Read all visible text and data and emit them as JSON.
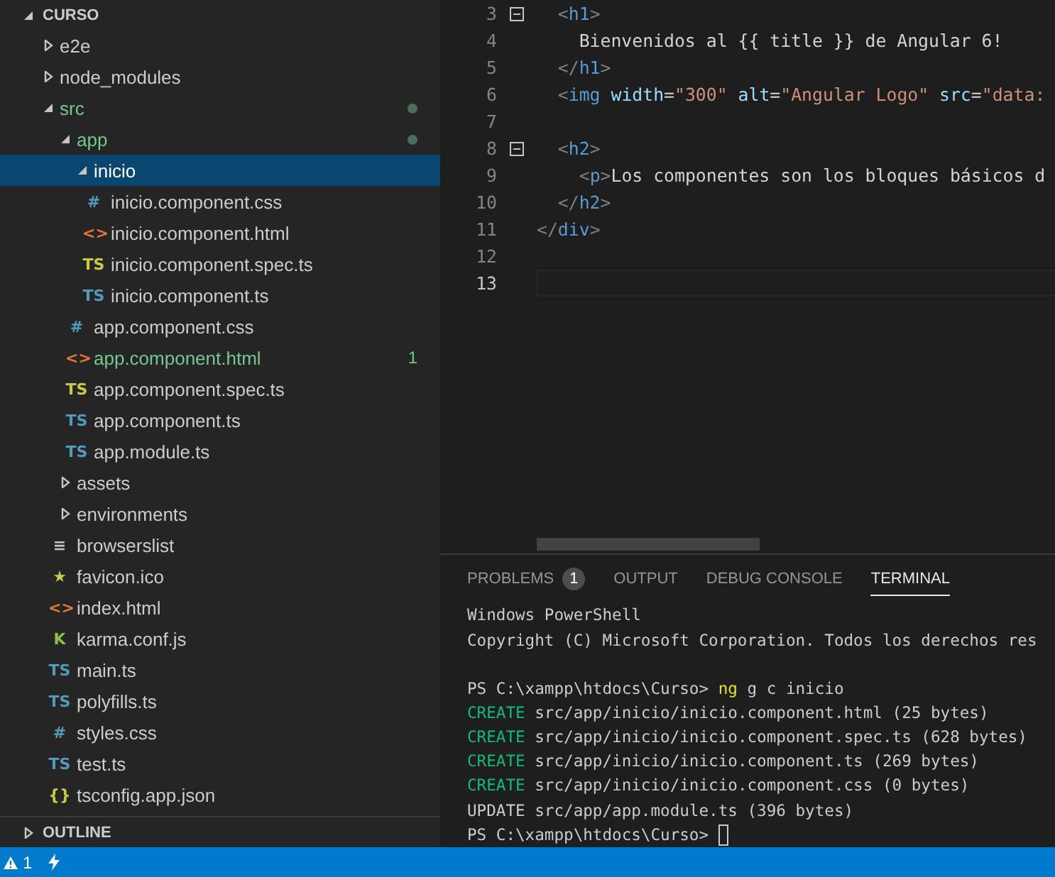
{
  "explorer": {
    "title": "CURSO",
    "expanded": true,
    "tree": [
      {
        "name": "e2e",
        "expanded": false
      },
      {
        "name": "node_modules",
        "expanded": false
      },
      {
        "name": "src",
        "expanded": true,
        "modified": true,
        "dot": true,
        "children": [
          {
            "name": "app",
            "expanded": true,
            "modified": true,
            "dot": true,
            "children": [
              {
                "name": "inicio",
                "expanded": true,
                "selected": true,
                "children": [
                  {
                    "kind": "css",
                    "icon": "#",
                    "name": "inicio.component.css"
                  },
                  {
                    "kind": "html",
                    "icon": "<>",
                    "name": "inicio.component.html"
                  },
                  {
                    "kind": "spec",
                    "icon": "TS",
                    "name": "inicio.component.spec.ts"
                  },
                  {
                    "kind": "ts",
                    "icon": "TS",
                    "name": "inicio.component.ts"
                  }
                ]
              },
              {
                "kind": "css",
                "icon": "#",
                "name": "app.component.css"
              },
              {
                "kind": "html",
                "icon": "<>",
                "name": "app.component.html",
                "modified": true,
                "badge": "1"
              },
              {
                "kind": "spec",
                "icon": "TS",
                "name": "app.component.spec.ts"
              },
              {
                "kind": "ts",
                "icon": "TS",
                "name": "app.component.ts"
              },
              {
                "kind": "ts",
                "icon": "TS",
                "name": "app.module.ts"
              }
            ]
          },
          {
            "name": "assets",
            "expanded": false
          },
          {
            "name": "environments",
            "expanded": false
          },
          {
            "kind": "list",
            "icon": "≡",
            "name": "browserslist"
          },
          {
            "kind": "favicon",
            "icon": "★",
            "name": "favicon.ico"
          },
          {
            "kind": "html",
            "icon": "<>",
            "name": "index.html"
          },
          {
            "kind": "karma",
            "icon": "K",
            "name": "karma.conf.js"
          },
          {
            "kind": "ts",
            "icon": "TS",
            "name": "main.ts"
          },
          {
            "kind": "ts",
            "icon": "TS",
            "name": "polyfills.ts"
          },
          {
            "kind": "css",
            "icon": "#",
            "name": "styles.css"
          },
          {
            "kind": "ts",
            "icon": "TS",
            "name": "test.ts"
          },
          {
            "kind": "json",
            "icon": "{}",
            "name": "tsconfig.app.json"
          }
        ]
      }
    ]
  },
  "outline": {
    "title": "OUTLINE",
    "expanded": false
  },
  "editor": {
    "lines": [
      {
        "number": "3",
        "foldable": true,
        "current": false,
        "tokens": [
          {
            "kind": "punct",
            "text": "  <"
          },
          {
            "kind": "tag",
            "text": "h1"
          },
          {
            "kind": "punct",
            "text": ">"
          }
        ]
      },
      {
        "number": "4",
        "foldable": false,
        "current": false,
        "tokens": [
          {
            "kind": "text",
            "text": "    Bienvenidos al {{ title }} de Angular 6!"
          }
        ]
      },
      {
        "number": "5",
        "foldable": false,
        "current": false,
        "tokens": [
          {
            "kind": "punct",
            "text": "  </"
          },
          {
            "kind": "tag",
            "text": "h1"
          },
          {
            "kind": "punct",
            "text": ">"
          }
        ]
      },
      {
        "number": "6",
        "foldable": false,
        "current": false,
        "tokens": [
          {
            "kind": "punct",
            "text": "  <"
          },
          {
            "kind": "tag",
            "text": "img"
          },
          {
            "kind": "attr",
            "text": " width"
          },
          {
            "kind": "text",
            "text": "="
          },
          {
            "kind": "string",
            "text": "\"300\""
          },
          {
            "kind": "attr",
            "text": " alt"
          },
          {
            "kind": "text",
            "text": "="
          },
          {
            "kind": "string",
            "text": "\"Angular Logo\""
          },
          {
            "kind": "attr",
            "text": " src"
          },
          {
            "kind": "text",
            "text": "="
          },
          {
            "kind": "string",
            "text": "\"data:"
          }
        ]
      },
      {
        "number": "7",
        "foldable": false,
        "current": false
      },
      {
        "number": "8",
        "foldable": true,
        "current": false,
        "tokens": [
          {
            "kind": "punct",
            "text": "  <"
          },
          {
            "kind": "tag",
            "text": "h2"
          },
          {
            "kind": "punct",
            "text": ">"
          }
        ]
      },
      {
        "number": "9",
        "foldable": false,
        "current": false,
        "tokens": [
          {
            "kind": "punct",
            "text": "    <"
          },
          {
            "kind": "tag",
            "text": "p"
          },
          {
            "kind": "punct",
            "text": ">"
          },
          {
            "kind": "text",
            "text": "Los componentes son los bloques básicos d"
          }
        ]
      },
      {
        "number": "10",
        "foldable": false,
        "current": false,
        "tokens": [
          {
            "kind": "punct",
            "text": "  </"
          },
          {
            "kind": "tag",
            "text": "h2"
          },
          {
            "kind": "punct",
            "text": ">"
          }
        ]
      },
      {
        "number": "11",
        "foldable": false,
        "current": false,
        "tokens": [
          {
            "kind": "punct",
            "text": "</"
          },
          {
            "kind": "tag",
            "text": "div"
          },
          {
            "kind": "punct",
            "text": ">"
          }
        ]
      },
      {
        "number": "12",
        "foldable": false,
        "current": false
      },
      {
        "number": "13",
        "foldable": false,
        "current": true
      }
    ]
  },
  "panel": {
    "tabs": [
      {
        "label": "PROBLEMS",
        "selected": false,
        "badge": "1"
      },
      {
        "label": "OUTPUT",
        "selected": false
      },
      {
        "label": "DEBUG CONSOLE",
        "selected": false
      },
      {
        "label": "TERMINAL",
        "selected": true
      }
    ],
    "terminal": {
      "blocks": [
        [
          [
            {
              "kind": "out",
              "text": "Windows PowerShell"
            }
          ],
          [
            {
              "kind": "out",
              "text": "Copyright (C) Microsoft Corporation. Todos los derechos res"
            }
          ]
        ],
        [
          [
            {
              "kind": "out",
              "text": "PS C:\\xampp\\htdocs\\Curso> "
            },
            {
              "kind": "cmd",
              "text": "ng"
            },
            {
              "kind": "out",
              "text": " g c inicio"
            }
          ],
          [
            {
              "kind": "create",
              "text": "CREATE"
            },
            {
              "kind": "out",
              "text": " src/app/inicio/inicio.component.html (25 bytes)"
            }
          ],
          [
            {
              "kind": "create",
              "text": "CREATE"
            },
            {
              "kind": "out",
              "text": " src/app/inicio/inicio.component.spec.ts (628 bytes)"
            }
          ],
          [
            {
              "kind": "create",
              "text": "CREATE"
            },
            {
              "kind": "out",
              "text": " src/app/inicio/inicio.component.ts (269 bytes)"
            }
          ],
          [
            {
              "kind": "create",
              "text": "CREATE"
            },
            {
              "kind": "out",
              "text": " src/app/inicio/inicio.component.css (0 bytes)"
            }
          ],
          [
            {
              "kind": "out",
              "text": "UPDATE src/app/app.module.ts (396 bytes)"
            }
          ],
          [
            {
              "kind": "out",
              "text": "PS C:\\xampp\\htdocs\\Curso> "
            },
            {
              "kind": "cursor"
            }
          ]
        ]
      ]
    }
  },
  "status_bar": {
    "warnings": "1"
  }
}
